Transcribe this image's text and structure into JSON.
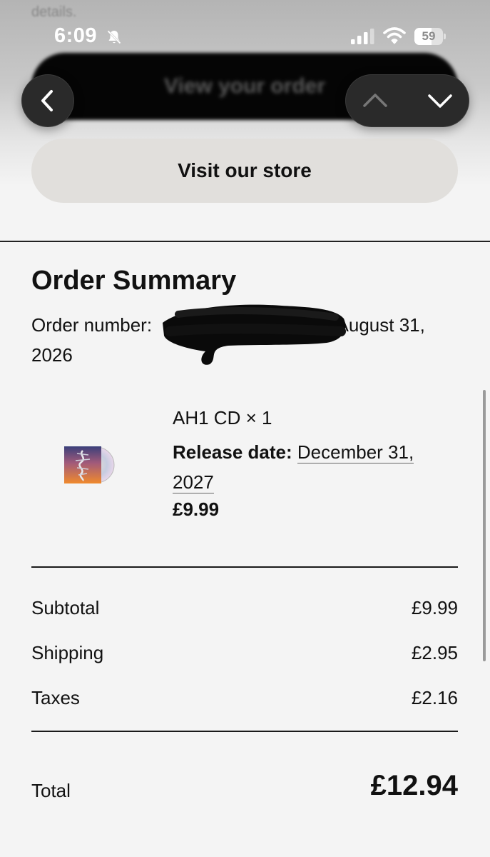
{
  "status_bar": {
    "time": "6:09",
    "battery_level": "59",
    "battery_fraction": 0.59
  },
  "header": {
    "ghost_text": "details.",
    "view_order_label": "View your order",
    "visit_store_label": "Visit our store"
  },
  "order_summary": {
    "title": "Order Summary",
    "order_number_label": "Order number:",
    "order_date_part1": "- August 31,",
    "order_date_part2": "2026"
  },
  "product": {
    "name": "AH1 CD × 1",
    "release_label": "Release date:",
    "release_date_part1": "December 31,",
    "release_date_part2": "2027",
    "price": "£9.99"
  },
  "costs": {
    "subtotal_label": "Subtotal",
    "subtotal_value": "£9.99",
    "shipping_label": "Shipping",
    "shipping_value": "£2.95",
    "taxes_label": "Taxes",
    "taxes_value": "£2.16"
  },
  "total": {
    "label": "Total",
    "value": "£12.94"
  },
  "colors": {
    "page_background": "#f4f4f4",
    "store_button": "#e1dfdc",
    "view_order_button": "#050505"
  },
  "icons": {
    "back": "chevron-left-icon",
    "up": "chevron-up-icon",
    "down": "chevron-down-icon",
    "mute": "bell-slash-icon",
    "signal": "cellular-signal-icon",
    "wifi": "wifi-icon"
  }
}
